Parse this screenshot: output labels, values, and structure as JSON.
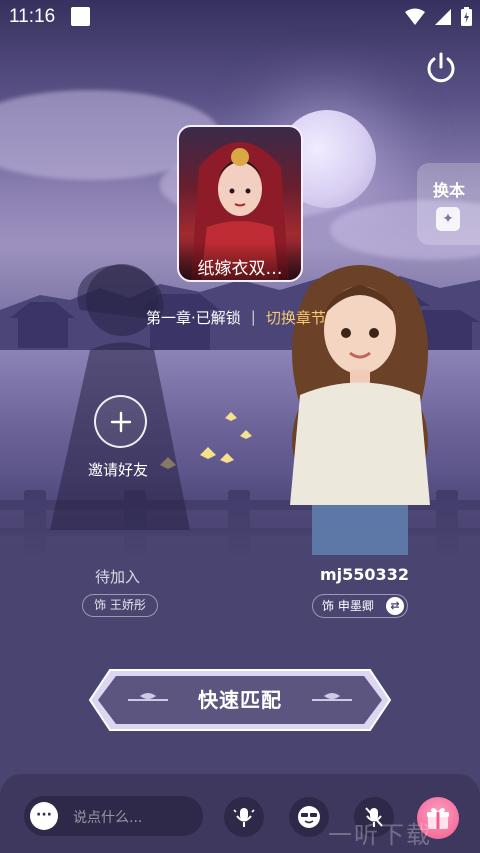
{
  "status_bar": {
    "time": "11:16"
  },
  "side_panel": {
    "change_book_label": "换本"
  },
  "book": {
    "title": "纸嫁衣双…"
  },
  "chapter": {
    "status": "第一章·已解锁",
    "divider": "|",
    "switch_label": "切换章节"
  },
  "invite": {
    "label": "邀请好友"
  },
  "players": [
    {
      "name": "待加入",
      "role": "饰 王娇彤"
    },
    {
      "name": "mj550332",
      "role": "饰 申墨卿"
    }
  ],
  "quick_match": {
    "label": "快速匹配"
  },
  "bottom_bar": {
    "chat_placeholder": "说点什么..."
  },
  "watermark": {
    "text": "一听下载"
  },
  "colors": {
    "accent": "#f5c974",
    "background": "#4a4470",
    "bar": "#3e385e",
    "gift": "#f05d8f"
  }
}
